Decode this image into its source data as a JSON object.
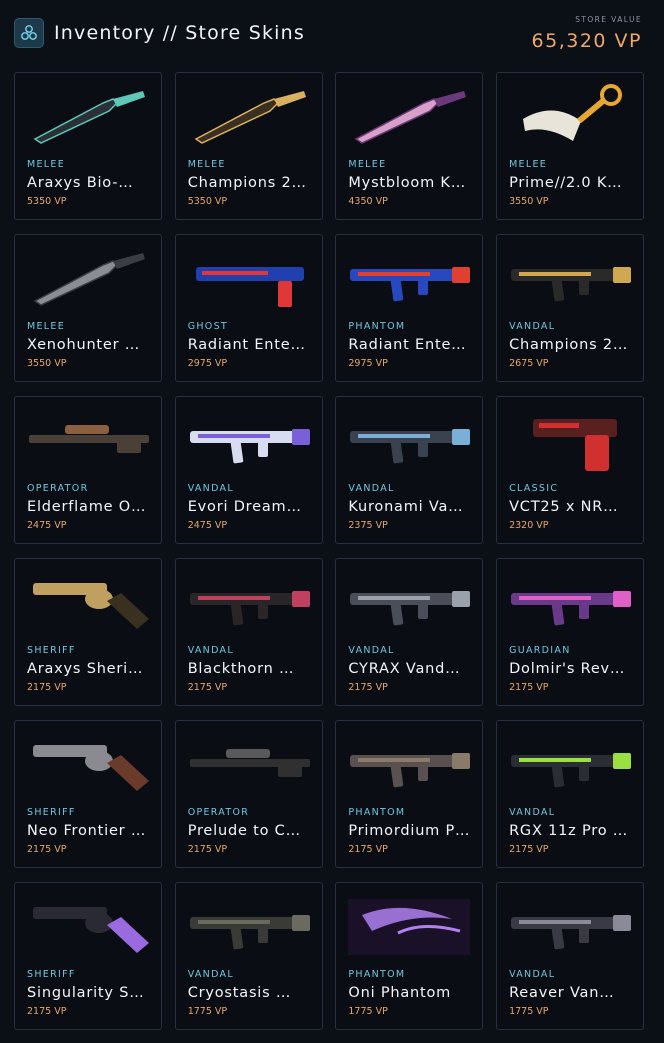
{
  "header": {
    "title": "Inventory // Store Skins",
    "store_value_label": "STORE VALUE",
    "store_value": "65,320 VP"
  },
  "items": [
    {
      "type": "MELEE",
      "name": "Araxys Bio-…",
      "price": "5350 VP",
      "icon": "melee-knife-icon",
      "colors": [
        "#2a2f38",
        "#5ec7b8"
      ]
    },
    {
      "type": "MELEE",
      "name": "Champions 2…",
      "price": "5350 VP",
      "icon": "melee-knife-icon",
      "colors": [
        "#3a2f20",
        "#d8b060"
      ]
    },
    {
      "type": "MELEE",
      "name": "Mystbloom K…",
      "price": "4350 VP",
      "icon": "melee-knife-icon",
      "colors": [
        "#d8a0c8",
        "#6a3a7a"
      ]
    },
    {
      "type": "MELEE",
      "name": "Prime//2.0 K…",
      "price": "3550 VP",
      "icon": "melee-karambit-icon",
      "colors": [
        "#e8e4da",
        "#e8a830"
      ]
    },
    {
      "type": "MELEE",
      "name": "Xenohunter …",
      "price": "3550 VP",
      "icon": "melee-knife-icon",
      "colors": [
        "#8a8e94",
        "#3a3e44"
      ]
    },
    {
      "type": "GHOST",
      "name": "Radiant Ente…",
      "price": "2975 VP",
      "icon": "ghost-pistol-icon",
      "colors": [
        "#2040b0",
        "#e03838"
      ]
    },
    {
      "type": "PHANTOM",
      "name": "Radiant Ente…",
      "price": "2975 VP",
      "icon": "phantom-rifle-icon",
      "colors": [
        "#2848c0",
        "#e04030"
      ]
    },
    {
      "type": "VANDAL",
      "name": "Champions 2…",
      "price": "2675 VP",
      "icon": "vandal-rifle-icon",
      "colors": [
        "#2a2a2a",
        "#d0a850"
      ]
    },
    {
      "type": "OPERATOR",
      "name": "Elderflame O…",
      "price": "2475 VP",
      "icon": "operator-sniper-icon",
      "colors": [
        "#4a4038",
        "#8a6040"
      ]
    },
    {
      "type": "VANDAL",
      "name": "Evori Dream…",
      "price": "2475 VP",
      "icon": "vandal-rifle-icon",
      "colors": [
        "#d8dcf0",
        "#7a60d8"
      ]
    },
    {
      "type": "VANDAL",
      "name": "Kuronami Va…",
      "price": "2375 VP",
      "icon": "vandal-rifle-icon",
      "colors": [
        "#3a4250",
        "#7ab0d8"
      ]
    },
    {
      "type": "CLASSIC",
      "name": "VCT25 x NR…",
      "price": "2320 VP",
      "icon": "classic-pistol-icon",
      "colors": [
        "#5a2020",
        "#d03030"
      ]
    },
    {
      "type": "SHERIFF",
      "name": "Araxys Sheri…",
      "price": "2175 VP",
      "icon": "sheriff-revolver-icon",
      "colors": [
        "#c0a060",
        "#3a3020"
      ]
    },
    {
      "type": "VANDAL",
      "name": "Blackthorn …",
      "price": "2175 VP",
      "icon": "vandal-rifle-icon",
      "colors": [
        "#2a2628",
        "#c04060"
      ]
    },
    {
      "type": "VANDAL",
      "name": "CYRAX Vand…",
      "price": "2175 VP",
      "icon": "vandal-rifle-icon",
      "colors": [
        "#4a4e58",
        "#9aa0ac"
      ]
    },
    {
      "type": "GUARDIAN",
      "name": "Dolmir's Rev…",
      "price": "2175 VP",
      "icon": "guardian-rifle-icon",
      "colors": [
        "#6a3a8a",
        "#e060c8"
      ]
    },
    {
      "type": "SHERIFF",
      "name": "Neo Frontier …",
      "price": "2175 VP",
      "icon": "sheriff-revolver-icon",
      "colors": [
        "#8a8a90",
        "#6a3a2a"
      ]
    },
    {
      "type": "OPERATOR",
      "name": "Prelude to C…",
      "price": "2175 VP",
      "icon": "operator-sniper-icon",
      "colors": [
        "#303030",
        "#5a5a5a"
      ]
    },
    {
      "type": "PHANTOM",
      "name": "Primordium P…",
      "price": "2175 VP",
      "icon": "phantom-rifle-icon",
      "colors": [
        "#5a5050",
        "#8a7a6a"
      ]
    },
    {
      "type": "VANDAL",
      "name": "RGX 11z Pro …",
      "price": "2175 VP",
      "icon": "vandal-rifle-icon",
      "colors": [
        "#2a2e34",
        "#9ae040"
      ]
    },
    {
      "type": "SHERIFF",
      "name": "Singularity S…",
      "price": "2175 VP",
      "icon": "sheriff-revolver-icon",
      "colors": [
        "#2a2a34",
        "#9a6ae0"
      ]
    },
    {
      "type": "VANDAL",
      "name": "Cryostasis …",
      "price": "1775 VP",
      "icon": "vandal-rifle-icon",
      "colors": [
        "#3a3a36",
        "#6a6a5e"
      ]
    },
    {
      "type": "PHANTOM",
      "name": "Oni Phantom",
      "price": "1775 VP",
      "icon": "phantom-panel-icon",
      "colors": [
        "#1a1028",
        "#b080f0"
      ]
    },
    {
      "type": "VANDAL",
      "name": "Reaver Van…",
      "price": "1775 VP",
      "icon": "vandal-rifle-icon",
      "colors": [
        "#3a3a44",
        "#8a8a98"
      ]
    }
  ]
}
